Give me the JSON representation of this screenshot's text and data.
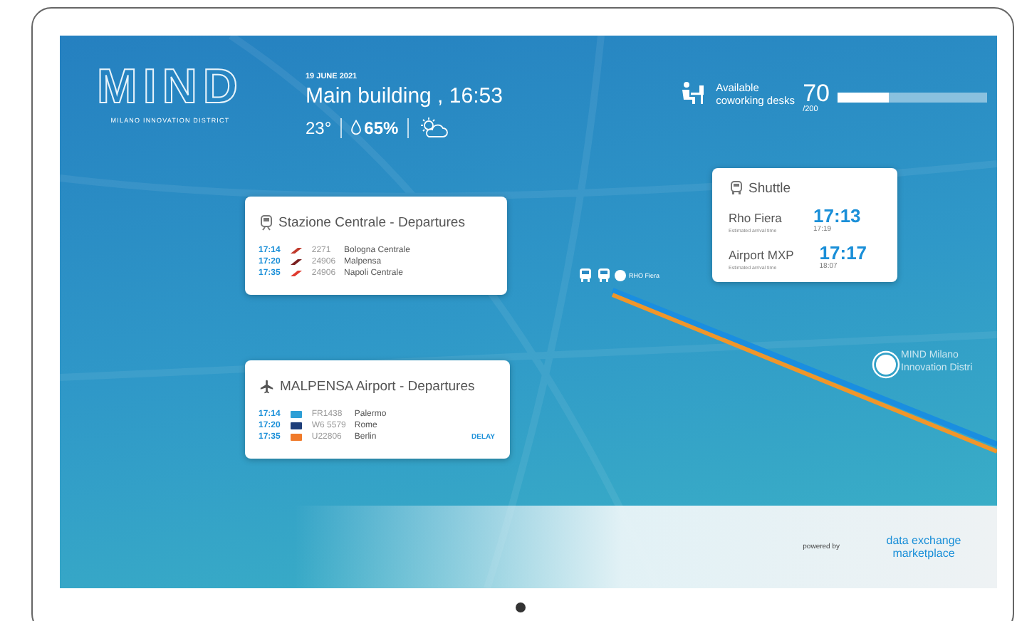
{
  "logo": {
    "wordmark": "MIND",
    "tagline": "MILANO INNOVATION DISTRICT"
  },
  "header": {
    "date": "19 JUNE 2021",
    "title": "Main building , 16:53",
    "temperature": "23°",
    "humidity": "65%"
  },
  "desks": {
    "label": "Available coworking desks",
    "count": "70",
    "total": "/200",
    "level": 0.35
  },
  "train_board": {
    "title": "Stazione Centrale - Departures",
    "rows": [
      {
        "time": "17:14",
        "number": "2271",
        "destination": "Bologna Centrale",
        "color": "#c0392b"
      },
      {
        "time": "17:20",
        "number": "24906",
        "destination": "Malpensa",
        "color": "#7a1f1f"
      },
      {
        "time": "17:35",
        "number": "24906",
        "destination": "Napoli Centrale",
        "color": "#e03a2f"
      }
    ]
  },
  "flight_board": {
    "title": "MALPENSA Airport - Departures",
    "rows": [
      {
        "time": "17:14",
        "number": "FR1438",
        "destination": "Palermo",
        "color": "#2e9fd6"
      },
      {
        "time": "17:20",
        "number": "W6 5579",
        "destination": "Rome",
        "color": "#1f3f7a"
      },
      {
        "time": "17:35",
        "number": "U22806",
        "destination": "Berlin",
        "color": "#f07a2a",
        "status": "DELAY"
      }
    ]
  },
  "shuttle": {
    "title": "Shuttle",
    "rows": [
      {
        "destination": "Rho Fiera",
        "note": "Estimated arrival time",
        "time": "17:13",
        "arrival": "17:19"
      },
      {
        "destination": "Airport MXP",
        "note": "Estimated arrival time",
        "time": "17:17",
        "arrival": "18:07"
      }
    ]
  },
  "map": {
    "station_label": "RHO Fiera",
    "destination_label": "MIND Milano Innovation Distri"
  },
  "footer": {
    "powered_by": "powered by",
    "brand": "data exchange marketplace"
  }
}
